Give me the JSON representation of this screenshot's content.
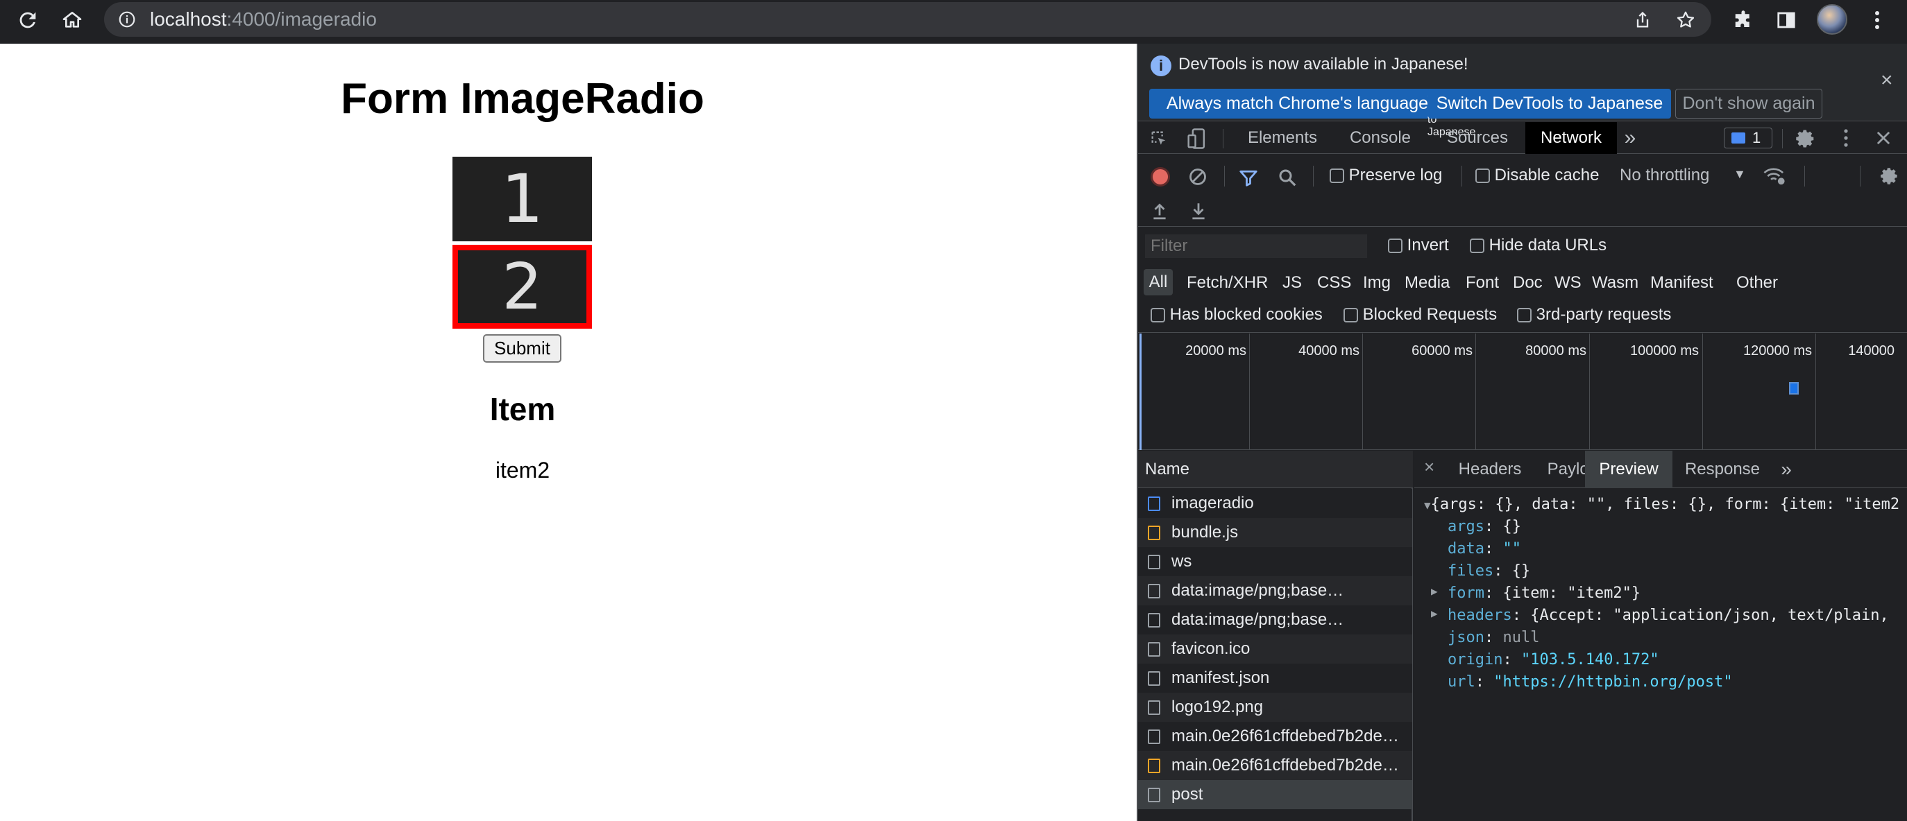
{
  "browser": {
    "address_host": "localhost",
    "address_path": ":4000/imageradio"
  },
  "page": {
    "title": "Form ImageRadio",
    "radio_options": [
      "1",
      "2"
    ],
    "selected_option": "2",
    "submit_label": "Submit",
    "section_heading": "Item",
    "result": "item2"
  },
  "devtools": {
    "banner": {
      "message": "DevTools is now available in Japanese!",
      "btn_match": "Always match Chrome's language",
      "btn_switch": "Switch DevTools to Japanese",
      "btn_dont_show": "Don't show again",
      "close": "×"
    },
    "tabs": [
      "Elements",
      "Console",
      "Sources",
      "Network"
    ],
    "active_tab": "Network",
    "more_tabs": "»",
    "issues_count": "1",
    "toolbar": {
      "preserve_log": "Preserve log",
      "disable_cache": "Disable cache",
      "throttling": "No throttling"
    },
    "filter": {
      "placeholder": "Filter",
      "invert": "Invert",
      "hide_data_urls": "Hide data URLs"
    },
    "type_filters": [
      "All",
      "Fetch/XHR",
      "JS",
      "CSS",
      "Img",
      "Media",
      "Font",
      "Doc",
      "WS",
      "Wasm",
      "Manifest",
      "Other"
    ],
    "checks": {
      "blocked_cookies": "Has blocked cookies",
      "blocked_requests": "Blocked Requests",
      "third_party": "3rd-party requests"
    },
    "timeline_ticks": [
      "20000 ms",
      "40000 ms",
      "60000 ms",
      "80000 ms",
      "100000 ms",
      "120000 ms",
      "140000"
    ],
    "requests_header": "Name",
    "requests": [
      {
        "name": "imageradio",
        "icon": "document-icon",
        "color": "#4b8bf5"
      },
      {
        "name": "bundle.js",
        "icon": "script-icon",
        "color": "#f0a527"
      },
      {
        "name": "ws",
        "icon": "file-icon",
        "color": "#9aa0a6"
      },
      {
        "name": "data:image/png;base…",
        "icon": "image-icon",
        "color": "#9aa0a6"
      },
      {
        "name": "data:image/png;base…",
        "icon": "image-icon",
        "color": "#9aa0a6"
      },
      {
        "name": "favicon.ico",
        "icon": "file-icon",
        "color": "#9aa0a6"
      },
      {
        "name": "manifest.json",
        "icon": "file-icon",
        "color": "#9aa0a6"
      },
      {
        "name": "logo192.png",
        "icon": "file-icon",
        "color": "#9aa0a6"
      },
      {
        "name": "main.0e26f61cffdebed7b2de…",
        "icon": "file-icon",
        "color": "#9aa0a6"
      },
      {
        "name": "main.0e26f61cffdebed7b2de…",
        "icon": "script-icon",
        "color": "#f0a527"
      },
      {
        "name": "post",
        "icon": "file-icon",
        "color": "#9aa0a6"
      }
    ],
    "detail_tabs": [
      "Headers",
      "Payload",
      "Preview",
      "Response"
    ],
    "active_detail_tab": "Preview",
    "preview": {
      "root": "{args: {}, data: \"\", files: {}, form: {item: \"item2",
      "lines": [
        {
          "key": "args",
          "value": "{}",
          "type": "w"
        },
        {
          "key": "data",
          "value": "\"\"",
          "type": "s"
        },
        {
          "key": "files",
          "value": "{}",
          "type": "w"
        },
        {
          "key": "form",
          "value": "{item: \"item2\"}",
          "type": "w",
          "expandable": true
        },
        {
          "key": "headers",
          "value": "{Accept: \"application/json, text/plain,",
          "type": "w",
          "expandable": true
        },
        {
          "key": "json",
          "value": "null",
          "type": "n"
        },
        {
          "key": "origin",
          "value": "\"103.5.140.172\"",
          "type": "s"
        },
        {
          "key": "url",
          "value": "\"https://httpbin.org/post\"",
          "type": "s"
        }
      ]
    }
  }
}
